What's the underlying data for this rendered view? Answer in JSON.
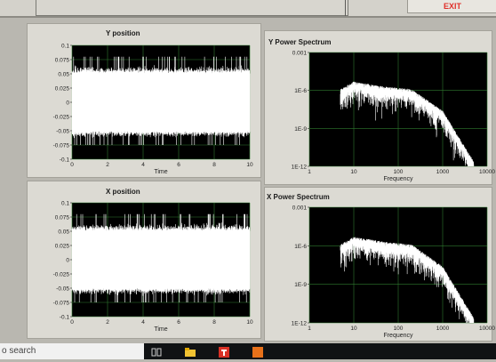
{
  "app": {
    "exit_label": "EXIT"
  },
  "charts": [
    {
      "id": "y_position",
      "title": "Y position",
      "xlabel": "Time",
      "yticks": [
        "0.1",
        "0.075",
        "0.05",
        "0.025",
        "0",
        "-0.025",
        "-0.05",
        "-0.075",
        "-0.1"
      ],
      "xticks": [
        "0",
        "2",
        "4",
        "6",
        "8",
        "10"
      ]
    },
    {
      "id": "y_power",
      "title": "Y Power Spectrum",
      "xlabel": "Frequency",
      "yticks": [
        "0.001",
        "1E-6",
        "1E-9",
        "1E-12"
      ],
      "xticks": [
        "1",
        "10",
        "100",
        "1000",
        "10000"
      ]
    },
    {
      "id": "x_position",
      "title": "X position",
      "xlabel": "Time",
      "yticks": [
        "0.1",
        "0.075",
        "0.05",
        "0.025",
        "0",
        "-0.025",
        "-0.05",
        "-0.075",
        "-0.1"
      ],
      "xticks": [
        "0",
        "2",
        "4",
        "6",
        "8",
        "10"
      ]
    },
    {
      "id": "x_power",
      "title": "X Power Spectrum",
      "xlabel": "Frequency",
      "yticks": [
        "0.001",
        "1E-6",
        "1E-9",
        "1E-12"
      ],
      "xticks": [
        "1",
        "10",
        "100",
        "1000",
        "10000"
      ]
    }
  ],
  "chart_data": [
    {
      "type": "line",
      "title": "Y position",
      "xlabel": "Time",
      "ylabel": "",
      "xlim": [
        0,
        10
      ],
      "ylim": [
        -0.1,
        0.1
      ],
      "grid": true,
      "signal": "noise",
      "typical_range": [
        -0.05,
        0.05
      ],
      "peak_range": [
        -0.075,
        0.08
      ]
    },
    {
      "type": "line",
      "title": "Y Power Spectrum",
      "xlabel": "Frequency",
      "ylabel": "",
      "xscale": "log",
      "yscale": "log",
      "xlim": [
        1,
        10000
      ],
      "ylim": [
        1e-12,
        0.001
      ],
      "grid": true,
      "envelope": {
        "frequency": [
          5,
          10,
          50,
          200,
          1000,
          5000
        ],
        "upper": [
          5e-07,
          2e-06,
          8e-07,
          5e-07,
          1e-08,
          1e-12
        ]
      }
    },
    {
      "type": "line",
      "title": "X position",
      "xlabel": "Time",
      "ylabel": "",
      "xlim": [
        0,
        10
      ],
      "ylim": [
        -0.1,
        0.1
      ],
      "grid": true,
      "signal": "noise",
      "typical_range": [
        -0.05,
        0.05
      ],
      "peak_range": [
        -0.075,
        0.08
      ]
    },
    {
      "type": "line",
      "title": "X Power Spectrum",
      "xlabel": "Frequency",
      "ylabel": "",
      "xscale": "log",
      "yscale": "log",
      "xlim": [
        1,
        10000
      ],
      "ylim": [
        1e-12,
        0.001
      ],
      "grid": true,
      "envelope": {
        "frequency": [
          5,
          10,
          50,
          200,
          1000,
          5000
        ],
        "upper": [
          5e-07,
          2e-06,
          8e-07,
          5e-07,
          1e-08,
          1e-12
        ]
      }
    }
  ],
  "taskbar": {
    "search_text": "o search"
  }
}
